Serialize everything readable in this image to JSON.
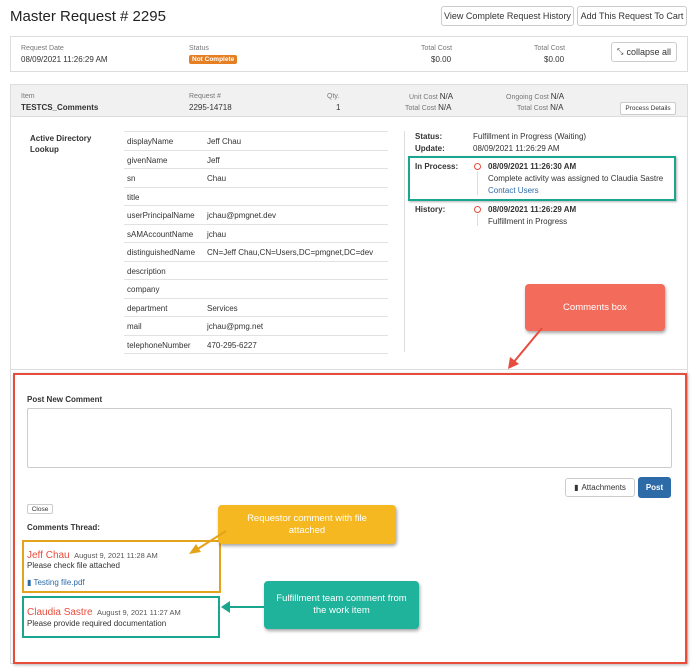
{
  "header": {
    "title": "Master Request # 2295",
    "history_btn": "View Complete Request History",
    "cart_btn": "Add This Request To Cart"
  },
  "summary": {
    "request_date_label": "Request Date",
    "request_date": "08/09/2021 11:26:29 AM",
    "status_label": "Status",
    "status_badge": "Not Complete",
    "total_cost_label_1": "Total Cost",
    "total_cost_1": "$0.00",
    "total_cost_label_2": "Total Cost",
    "total_cost_2": "$0.00",
    "collapse_btn": "collapse all"
  },
  "item": {
    "item_label": "Item",
    "item_name": "TESTCS_Comments",
    "request_num_label": "Request #",
    "request_num": "2295-14718",
    "qty_label": "Qty.",
    "qty": "1",
    "unit_cost_label": "Unit Cost",
    "unit_cost": "N/A",
    "total_cost_label": "Total Cost",
    "total_cost": "N/A",
    "ongoing_cost_label": "Ongoing Cost",
    "ongoing_cost": "N/A",
    "ongoing_total_label": "Total Cost",
    "ongoing_total": "N/A",
    "process_btn": "Process Details"
  },
  "ad_lookup": {
    "title": "Active Directory Lookup",
    "attributes": [
      {
        "key": "displayName",
        "value": "Jeff Chau"
      },
      {
        "key": "givenName",
        "value": "Jeff"
      },
      {
        "key": "sn",
        "value": "Chau"
      },
      {
        "key": "title",
        "value": ""
      },
      {
        "key": "userPrincipalName",
        "value": "jchau@pmgnet.dev"
      },
      {
        "key": "sAMAccountName",
        "value": "jchau"
      },
      {
        "key": "distinguishedName",
        "value": "CN=Jeff Chau,CN=Users,DC=pmgnet,DC=dev"
      },
      {
        "key": "description",
        "value": ""
      },
      {
        "key": "company",
        "value": ""
      },
      {
        "key": "department",
        "value": "Services"
      },
      {
        "key": "mail",
        "value": "jchau@pmg.net"
      },
      {
        "key": "telephoneNumber",
        "value": "470-295-6227"
      }
    ]
  },
  "status_panel": {
    "status_label": "Status:",
    "status_value": "Fulfillment in Progress (Waiting)",
    "update_label": "Update:",
    "update_value": "08/09/2021 11:26:29 AM",
    "in_process_label": "In Process:",
    "in_process_time": "08/09/2021 11:26:30 AM",
    "in_process_text": "Complete activity was assigned to Claudia Sastre",
    "contact_link": "Contact Users",
    "history_label": "History:",
    "history_time": "08/09/2021 11:26:29 AM",
    "history_text": "Fulfillment in Progress"
  },
  "comments": {
    "post_label": "Post New Comment",
    "attachments_btn": "Attachments",
    "post_btn": "Post",
    "close_btn": "Close",
    "thread_label": "Comments Thread:",
    "thread": [
      {
        "author": "Jeff Chau",
        "date": "August 9, 2021 11:28 AM",
        "text": "Please check file attached",
        "attachment": "Testing file.pdf"
      },
      {
        "author": "Claudia Sastre",
        "date": "August 9, 2021 11:27 AM",
        "text": "Please provide required documentation"
      }
    ]
  },
  "callouts": {
    "comments_box": "Comments box",
    "requestor": "Requestor comment with file attached",
    "fulfillment": "Fulfillment team comment from the work item"
  },
  "colors": {
    "accent_red": "#e74c3c",
    "teal": "#1aa58f",
    "gold": "#e3a31a",
    "post_blue": "#2c6aa8",
    "badge_orange": "#e67e22"
  }
}
